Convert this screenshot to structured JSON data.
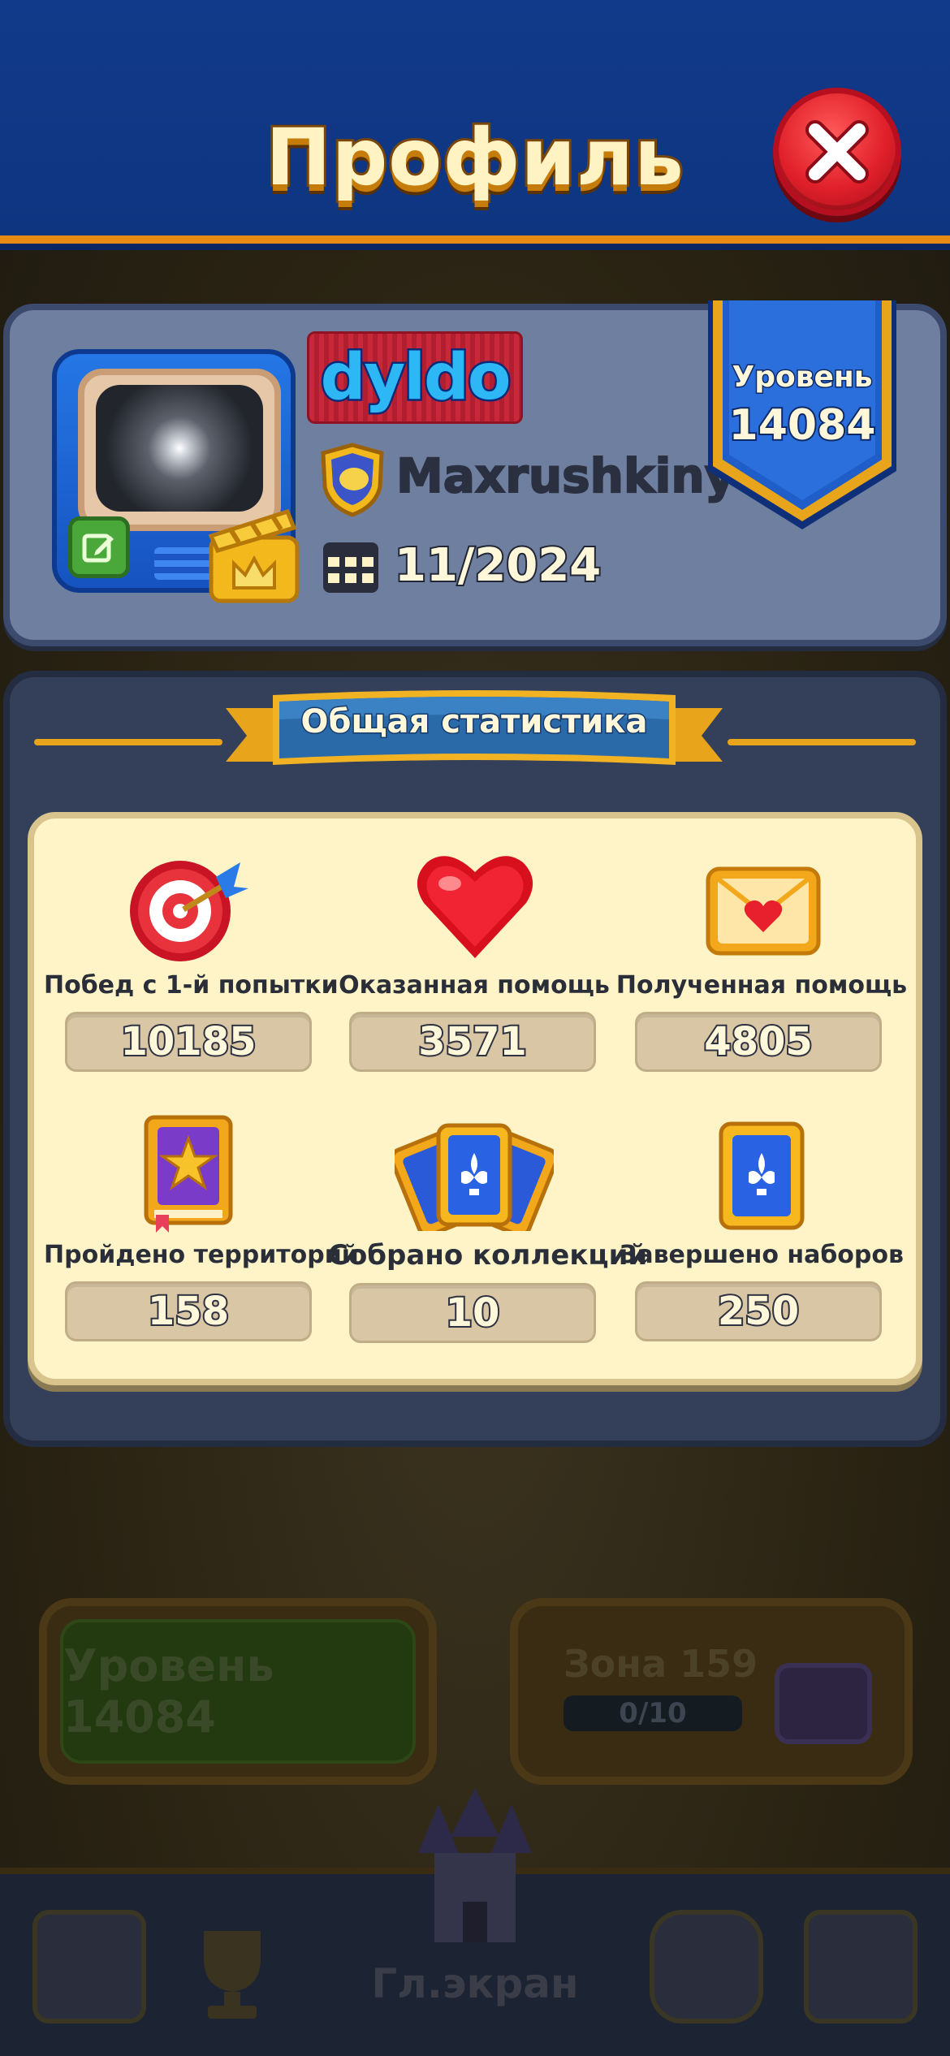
{
  "header": {
    "title": "Профиль"
  },
  "profile": {
    "player_name": "dyldo",
    "team_name": "Maxrushkiny",
    "join_date": "11/2024",
    "level_label": "Уровень",
    "level_value": "14084"
  },
  "stats": {
    "section_title": "Общая статистика",
    "items": [
      {
        "label": "Побед с 1-й попытки",
        "value": "10185",
        "icon": "target-icon"
      },
      {
        "label": "Оказанная помощь",
        "value": "3571",
        "icon": "heart-icon"
      },
      {
        "label": "Полученная помощь",
        "value": "4805",
        "icon": "envelope-icon"
      },
      {
        "label": "Пройдено территорий",
        "value": "158",
        "icon": "star-book-icon"
      },
      {
        "label": "Собрано коллекций",
        "value": "10",
        "icon": "card-fan-icon"
      },
      {
        "label": "Завершено наборов",
        "value": "250",
        "icon": "card-icon"
      }
    ]
  },
  "background": {
    "level_button": "Уровень 14084",
    "zone_title": "Зона 159",
    "zone_progress": "0/10",
    "home_label": "Гл.экран"
  },
  "colors": {
    "header_blue": "#113a8a",
    "accent_orange": "#e98a12",
    "panel_cream": "#fff3c8",
    "close_red": "#e0202a"
  }
}
